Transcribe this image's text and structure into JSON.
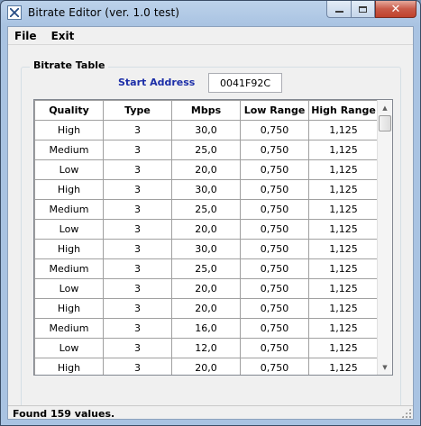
{
  "window": {
    "title": "Bitrate Editor (ver. 1.0 test)",
    "close_glyph": "✕"
  },
  "menu": {
    "file": "File",
    "exit": "Exit"
  },
  "group": {
    "title": "Bitrate Table",
    "start_address_label": "Start Address",
    "start_address_value": "0041F92C"
  },
  "table": {
    "columns": [
      "Quality",
      "Type",
      "Mbps",
      "Low Range",
      "High Range"
    ],
    "rows": [
      [
        "High",
        "3",
        "30,0",
        "0,750",
        "1,125"
      ],
      [
        "Medium",
        "3",
        "25,0",
        "0,750",
        "1,125"
      ],
      [
        "Low",
        "3",
        "20,0",
        "0,750",
        "1,125"
      ],
      [
        "High",
        "3",
        "30,0",
        "0,750",
        "1,125"
      ],
      [
        "Medium",
        "3",
        "25,0",
        "0,750",
        "1,125"
      ],
      [
        "Low",
        "3",
        "20,0",
        "0,750",
        "1,125"
      ],
      [
        "High",
        "3",
        "30,0",
        "0,750",
        "1,125"
      ],
      [
        "Medium",
        "3",
        "25,0",
        "0,750",
        "1,125"
      ],
      [
        "Low",
        "3",
        "20,0",
        "0,750",
        "1,125"
      ],
      [
        "High",
        "3",
        "20,0",
        "0,750",
        "1,125"
      ],
      [
        "Medium",
        "3",
        "16,0",
        "0,750",
        "1,125"
      ],
      [
        "Low",
        "3",
        "12,0",
        "0,750",
        "1,125"
      ],
      [
        "High",
        "3",
        "20,0",
        "0,750",
        "1,125"
      ]
    ]
  },
  "scrollbar": {
    "up_glyph": "▲",
    "down_glyph": "▼"
  },
  "status": {
    "text": "Found 159 values."
  }
}
